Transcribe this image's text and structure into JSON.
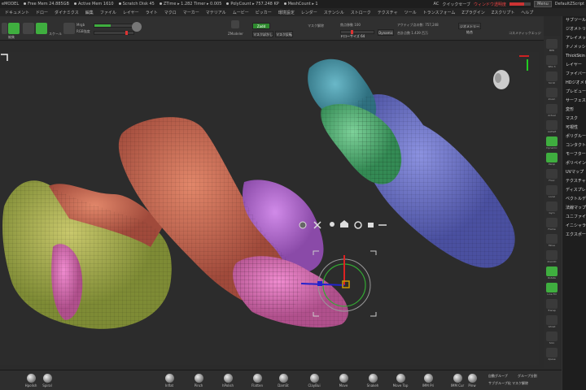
{
  "statusbar": {
    "app": "ZBrush",
    "items": [
      "eMODEL",
      "Free Mem 24.885GB",
      "Active Mem 1610",
      "Scratch Disk 45",
      "ZTime ▸ 1.282 Timer ▸ 0.005",
      "PolyCount ▸ 757.248 KP",
      "MeshCount ▸ 1"
    ],
    "ac": "AC",
    "quicksave": "クイックセーブ",
    "transparency": "ウィンドウ透明度",
    "menu": "Menu",
    "default_script": "DefaultZScript"
  },
  "menubar": [
    "ドキュメント",
    "ドロー",
    "ダイナミクス",
    "編集",
    "ファイル",
    "レイヤー",
    "ライト",
    "マクロ",
    "マーカー",
    "マテリアル",
    "ムービー",
    "ピッカー",
    "環境設定",
    "レンダー",
    "ステンシル",
    "ストローク",
    "テクスチャ",
    "ツール",
    "トランスフォーム",
    "Zプラグイン",
    "Zスクリプト",
    "ヘルプ"
  ],
  "toolbar": {
    "edit_label": "編集",
    "draw_label": "ドロー",
    "move_label": "移動",
    "scale_label": "スケール",
    "rotate_label": "回転",
    "mrgb": "Mrgb",
    "rgb": "Rgb",
    "m": "M",
    "zadd": "Zadd",
    "zsub": "Zsub",
    "rgb_intensity": "RGB強度",
    "z_intensity": "Z強度",
    "zmodeler_label": "ZModeler",
    "mask_invert": "マスク反転",
    "mask_blur": "マスクぼかし",
    "unmask": "マスク解除",
    "focal_shift_label": "焦点移動",
    "focal_shift_value": "100",
    "draw_size_label": "ドローサイズ",
    "draw_size_value": "64",
    "dynamic": "Dynamic",
    "active_points": "アクティブ点の数",
    "active_points_value": "757,248",
    "total_points": "合計点数",
    "total_points_value": "1.439 百万",
    "geometry_merge": "ジオメトリー結合",
    "cosmetic_label": "コスメティックエッジ"
  },
  "canvas": {
    "gizmo_icons": [
      "gear-icon",
      "x-icon",
      "pin-icon",
      "home-icon",
      "rotate-icon",
      "lock-icon",
      "minus-icon"
    ]
  },
  "right_tools": [
    "BPR",
    "SPix 3",
    "Scroll",
    "Zoom",
    "Actual",
    "AAHalf",
    "Dynamic",
    "Persp",
    "Floor",
    "Local",
    "Gyro",
    "Frame",
    "Move",
    "ZoomD",
    "Rotate",
    "Line Fill",
    "Transp",
    "Ghost",
    "Solo",
    "Xpose"
  ],
  "right_panel": [
    "サブツール",
    "ジオメトリ",
    "アレイメッシュ",
    "ナノメッシュ",
    "ThickSkin",
    "レイヤー",
    "ファイバーメッシュ",
    "HDジオメトリ",
    "プレビュー",
    "サーフェス",
    "変形",
    "マスク",
    "可視性",
    "ポリグループ",
    "コンタクト",
    "モーフターゲット",
    "ポリペイント",
    "UVマップ",
    "テクスチャマップ",
    "ディスプレイスメント",
    "ベクトルディスプレイスメント",
    "法線マップ",
    "ユニファイドスキン",
    "イニシャライズ",
    "エクスポート"
  ],
  "brushes": [
    "Hpolish",
    "Spiral",
    "Inflat",
    "Pinch",
    "hPolish",
    "Flatten",
    "DamSt",
    "ClayBui",
    "Move",
    "Snakeh",
    "Move Top",
    "IMM Pri",
    "IMM Cur",
    "Pinw"
  ],
  "bottom_buttons": {
    "auto_group": "自動グループ",
    "group_split": "グループ分割",
    "group_unmask": "サブグループ化 マスク解除"
  }
}
